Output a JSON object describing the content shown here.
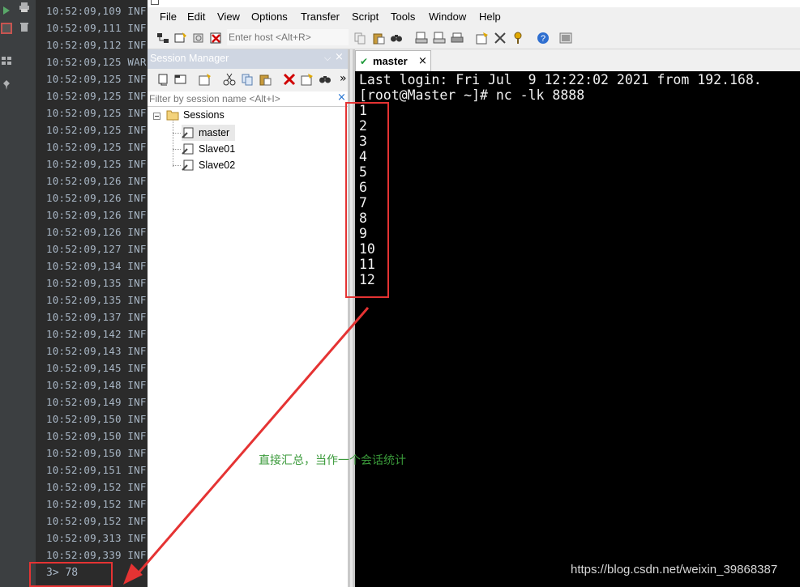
{
  "ide": {
    "gutter_icons": [
      "rerun-icon",
      "stop-icon",
      "layout-icon",
      "pin-icon",
      "print-icon",
      "trash-icon"
    ],
    "log_lines": [
      "10:52:09,109 INF",
      "10:52:09,111 INF",
      "10:52:09,112 INF",
      "10:52:09,125 WAR",
      "10:52:09,125 INF",
      "10:52:09,125 INF",
      "10:52:09,125 INF",
      "10:52:09,125 INF",
      "10:52:09,125 INF",
      "10:52:09,125 INF",
      "10:52:09,126 INF",
      "10:52:09,126 INF",
      "10:52:09,126 INF",
      "10:52:09,126 INF",
      "10:52:09,127 INF",
      "10:52:09,134 INF",
      "10:52:09,135 INF",
      "10:52:09,135 INF",
      "10:52:09,137 INF",
      "10:52:09,142 INF",
      "10:52:09,143 INF",
      "10:52:09,145 INF",
      "10:52:09,148 INF",
      "10:52:09,149 INF",
      "10:52:09,150 INF",
      "10:52:09,150 INF",
      "10:52:09,150 INF",
      "10:52:09,151 INF",
      "10:52:09,152 INF",
      "10:52:09,152 INF",
      "10:52:09,152 INF",
      "10:52:09,313 INF",
      "10:52:09,339 INF"
    ],
    "counter": "3> 78"
  },
  "crt": {
    "menu": [
      "File",
      "Edit",
      "View",
      "Options",
      "Transfer",
      "Script",
      "Tools",
      "Window",
      "Help"
    ],
    "enter_host_placeholder": "Enter host <Alt+R>",
    "session_manager": {
      "title": "Session Manager",
      "pin": "⌵",
      "close": "×",
      "filter_placeholder": "Filter by session name <Alt+I>",
      "filter_clear": "×",
      "tree": {
        "root": "Sessions",
        "items": [
          "master",
          "Slave01",
          "Slave02"
        ]
      }
    },
    "tab": {
      "label": "master",
      "close": "×"
    },
    "terminal_lines": [
      "Last login: Fri Jul  9 12:22:02 2021 from 192.168.",
      "[root@Master ~]# nc -lk 8888",
      "1",
      "2",
      "3",
      "4",
      "5",
      "6",
      "7",
      "8",
      "9",
      "10",
      "11",
      "12"
    ]
  },
  "annotation": {
    "text": "直接汇总，当作一个会话统计",
    "color": "#3a9a3a",
    "highlight_color": "#e53333"
  },
  "watermark": "https://blog.csdn.net/weixin_39868387"
}
